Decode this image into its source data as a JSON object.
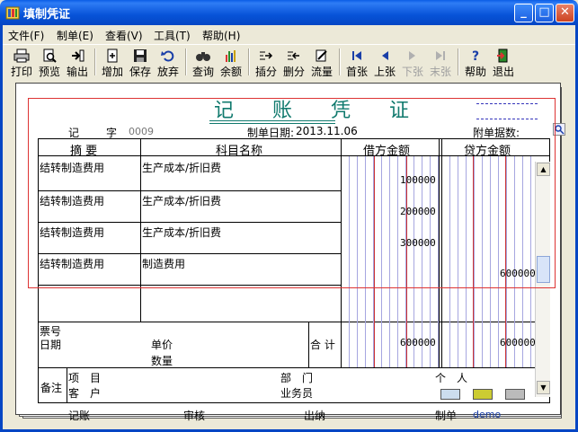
{
  "window": {
    "title": "填制凭证"
  },
  "menu": [
    "文件(F)",
    "制单(E)",
    "查看(V)",
    "工具(T)",
    "帮助(H)"
  ],
  "toolbar": [
    {
      "label": "打印",
      "icon": "printer-icon"
    },
    {
      "label": "预览",
      "icon": "preview-icon"
    },
    {
      "label": "输出",
      "icon": "export-icon"
    },
    {
      "label": "增加",
      "icon": "add-icon"
    },
    {
      "label": "保存",
      "icon": "save-icon"
    },
    {
      "label": "放弃",
      "icon": "undo-icon"
    },
    {
      "label": "查询",
      "icon": "binoculars-icon"
    },
    {
      "label": "余额",
      "icon": "balance-chart-icon"
    },
    {
      "label": "插分",
      "icon": "insert-row-icon"
    },
    {
      "label": "删分",
      "icon": "delete-row-icon"
    },
    {
      "label": "流量",
      "icon": "cashflow-icon"
    },
    {
      "label": "首张",
      "icon": "first-record-icon"
    },
    {
      "label": "上张",
      "icon": "prev-record-icon"
    },
    {
      "label": "下张",
      "icon": "next-record-icon"
    },
    {
      "label": "末张",
      "icon": "last-record-icon"
    },
    {
      "label": "帮助",
      "icon": "help-icon"
    },
    {
      "label": "退出",
      "icon": "exit-icon"
    }
  ],
  "voucher": {
    "title": "记 账 凭 证",
    "type_label": "记",
    "no_label": "字",
    "no_value": "0009",
    "date_label": "制单日期:",
    "date_value": "2013.11.06",
    "attach_label": "附单据数:",
    "columns": {
      "summary": "摘 要",
      "account": "科目名称",
      "debit": "借方金额",
      "credit": "贷方金额"
    },
    "rows": [
      {
        "summary": "结转制造费用",
        "account": "生产成本/折旧费",
        "debit": "100000",
        "credit": ""
      },
      {
        "summary": "结转制造费用",
        "account": "生产成本/折旧费",
        "debit": "200000",
        "credit": ""
      },
      {
        "summary": "结转制造费用",
        "account": "生产成本/折旧费",
        "debit": "300000",
        "credit": ""
      },
      {
        "summary": "结转制造费用",
        "account": "制造费用",
        "debit": "",
        "credit": "600000"
      }
    ],
    "bill_no_label": "票号",
    "date2_label": "日期",
    "unit_price_label": "单价",
    "quantity_label": "数量",
    "total_label": "合 计",
    "total_debit": "600000",
    "total_credit": "600000",
    "remark_label": "备注",
    "project_label": "项　目",
    "dept_label": "部　门",
    "person_label": "个　人",
    "customer_label": "客　户",
    "salesman_label": "业务员",
    "footer": {
      "bookkeeper": "记账",
      "auditor": "审核",
      "cashier": "出纳",
      "maker": "制单",
      "maker_value": "demo"
    }
  }
}
